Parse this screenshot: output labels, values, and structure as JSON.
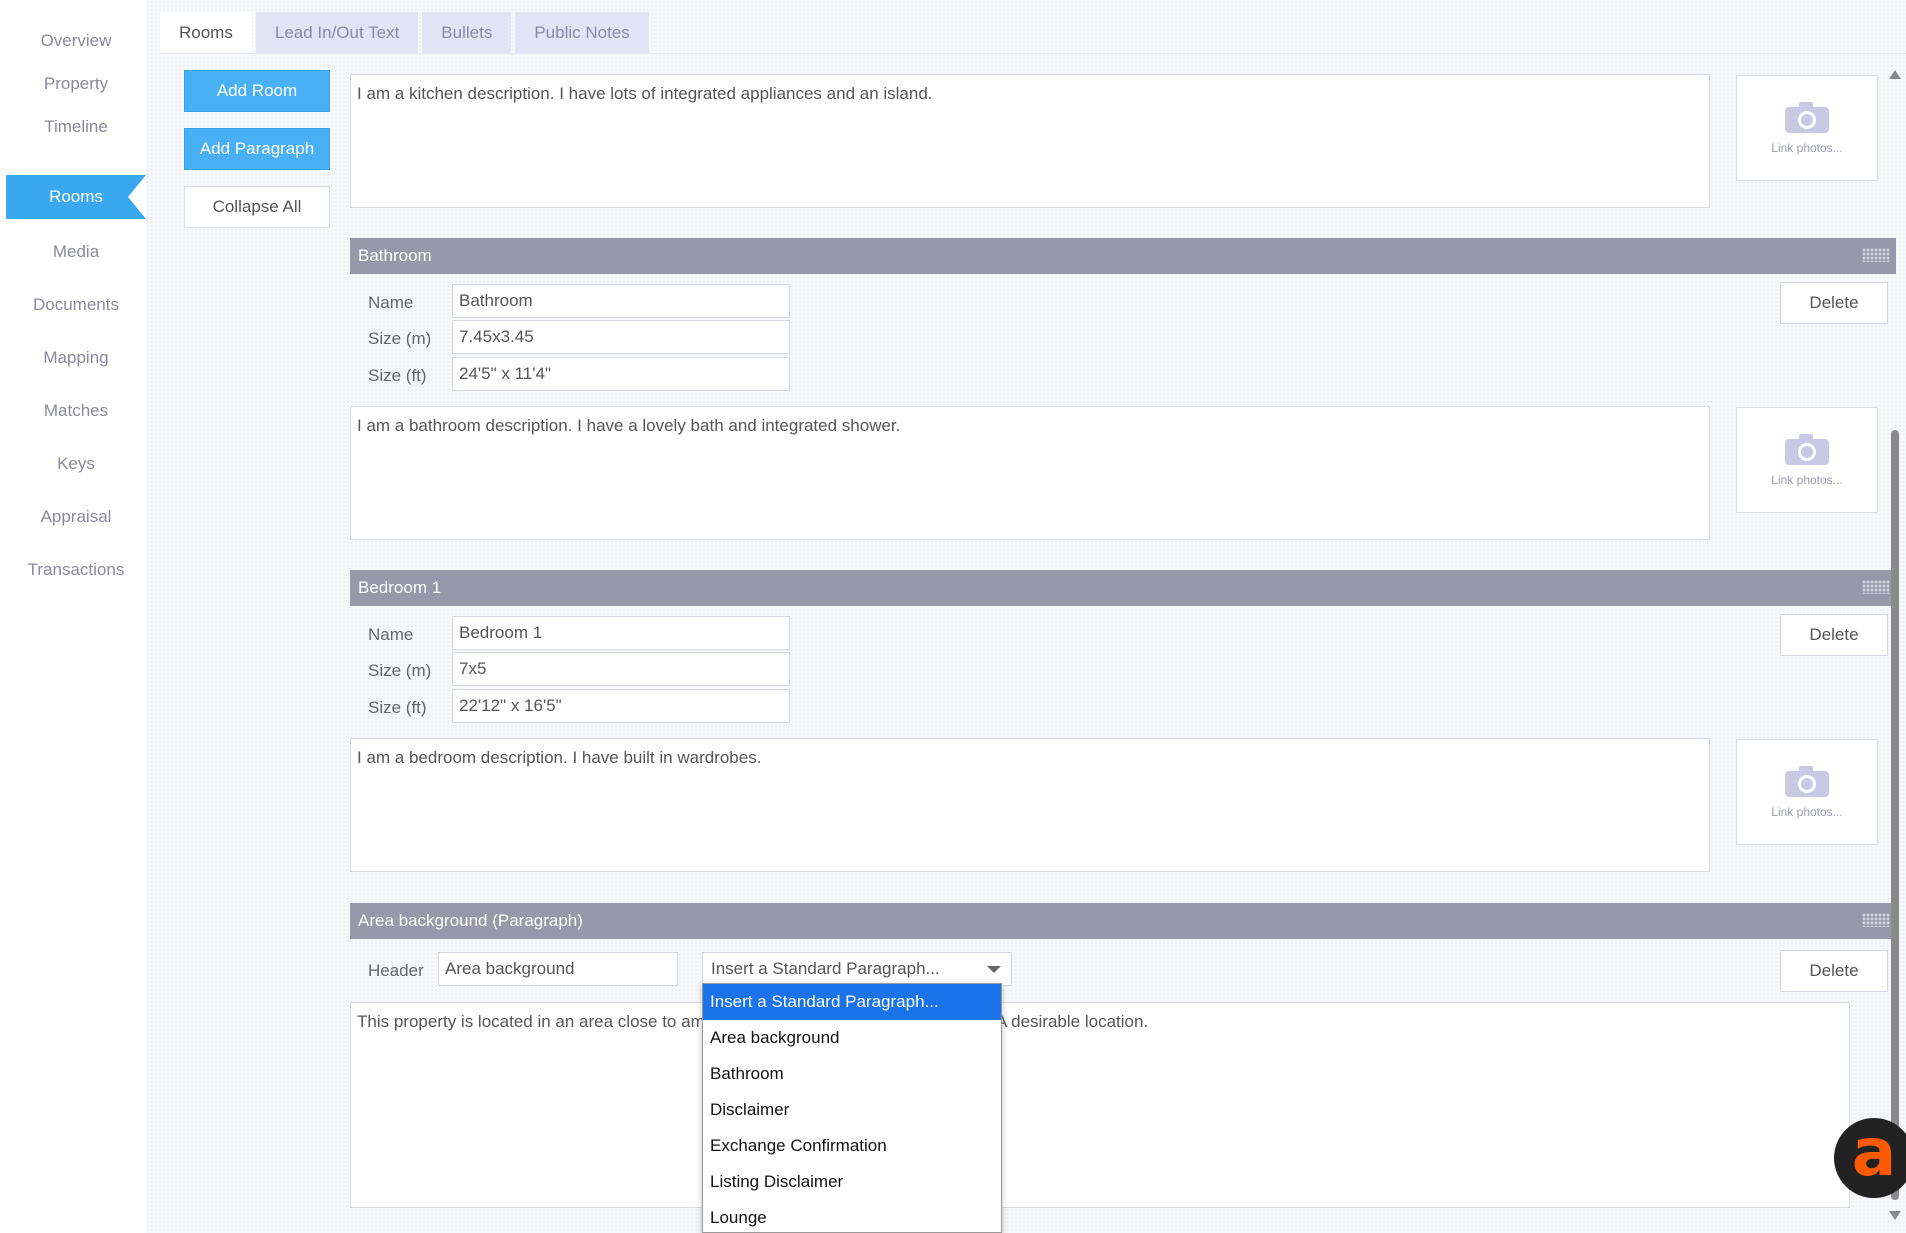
{
  "sidebar": {
    "items": [
      {
        "label": "Overview"
      },
      {
        "label": "Property"
      },
      {
        "label": "Timeline"
      },
      {
        "label": "Rooms"
      },
      {
        "label": "Media"
      },
      {
        "label": "Documents"
      },
      {
        "label": "Mapping"
      },
      {
        "label": "Matches"
      },
      {
        "label": "Keys"
      },
      {
        "label": "Appraisal"
      },
      {
        "label": "Transactions"
      }
    ],
    "active": "Rooms"
  },
  "tabs": [
    {
      "label": "Rooms"
    },
    {
      "label": "Lead In/Out Text"
    },
    {
      "label": "Bullets"
    },
    {
      "label": "Public Notes"
    }
  ],
  "actions": {
    "add_room": "Add Room",
    "add_paragraph": "Add Paragraph",
    "collapse_all": "Collapse All"
  },
  "labels": {
    "name": "Name",
    "size_m": "Size (m)",
    "size_ft": "Size (ft)",
    "header": "Header",
    "link_photos": "Link photos...",
    "delete": "Delete"
  },
  "kitchen": {
    "description": "I am a kitchen description. I have lots of integrated appliances and an island."
  },
  "bathroom": {
    "title": "Bathroom",
    "name": "Bathroom",
    "size_m": "7.45x3.45",
    "size_ft": "24'5\" x 11'4\"",
    "description": "I am a bathroom description. I have a lovely bath and integrated shower."
  },
  "bedroom1": {
    "title": "Bedroom 1",
    "name": "Bedroom 1",
    "size_m": "7x5",
    "size_ft": "22'12\" x 16'5\"",
    "description": "I am a bedroom description. I have built in wardrobes."
  },
  "paragraph": {
    "title": "Area background (Paragraph)",
    "header_value": "Area background",
    "select_value": "Insert a Standard Paragraph...",
    "text_left": "This property is located in an area close to am",
    "text_right": "A desirable location."
  },
  "dropdown": {
    "options": [
      "Insert a Standard Paragraph...",
      "Area background",
      "Bathroom",
      "Disclaimer",
      "Exchange Confirmation",
      "Listing Disclaimer",
      "Lounge"
    ],
    "selected_index": 0
  },
  "colors": {
    "accent": "#3aa8f0",
    "section_header": "#9898ab",
    "dropdown_highlight": "#1a73e8",
    "logo": "#ff5a00"
  },
  "logo": {
    "glyph": "a"
  }
}
